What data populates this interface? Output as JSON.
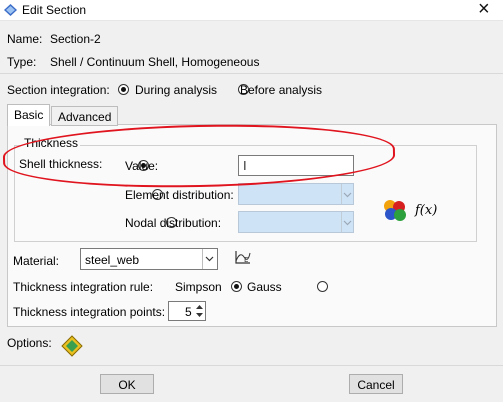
{
  "window": {
    "title": "Edit Section"
  },
  "section": {
    "name_label": "Name:",
    "name_value": "Section-2",
    "type_label": "Type:",
    "type_value": "Shell / Continuum Shell, Homogeneous"
  },
  "integration": {
    "label": "Section integration:",
    "options": [
      "During analysis",
      "Before analysis"
    ],
    "selected": "During analysis"
  },
  "tabs": [
    {
      "label": "Basic",
      "active": true
    },
    {
      "label": "Advanced",
      "active": false
    }
  ],
  "thickness": {
    "group_label": "Thickness",
    "shell_label": "Shell thickness:",
    "value_option": "Value:",
    "value_input": "",
    "element_option": "Element distribution:",
    "nodal_option": "Nodal distribution:",
    "selected": "Value:",
    "fx_label": "f(x)"
  },
  "material": {
    "label": "Material:",
    "value": "steel_web"
  },
  "rule": {
    "label": "Thickness integration rule:",
    "options": [
      "Simpson",
      "Gauss"
    ],
    "selected": "Simpson"
  },
  "points": {
    "label": "Thickness integration points:",
    "value": "5"
  },
  "options_row": {
    "label": "Options:"
  },
  "buttons": {
    "ok": "OK",
    "cancel": "Cancel"
  },
  "colors": {
    "annotation": "#e0141e",
    "combo_disabled": "#cfe3f7"
  }
}
